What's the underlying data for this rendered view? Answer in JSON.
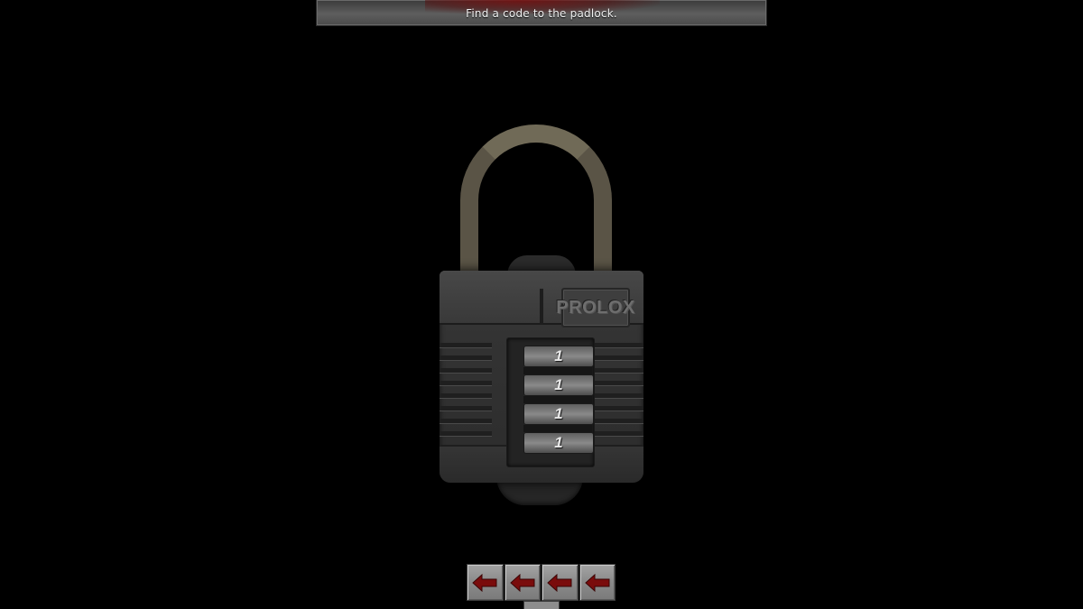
{
  "hint": {
    "text": "Find a code to the padlock."
  },
  "padlock": {
    "brand": "PROLOX",
    "dials": [
      {
        "value": "1"
      },
      {
        "value": "1"
      },
      {
        "value": "1"
      },
      {
        "value": "1"
      }
    ]
  },
  "controls": {
    "buttons": [
      {
        "icon": "left-arrow-icon"
      },
      {
        "icon": "left-arrow-icon"
      },
      {
        "icon": "left-arrow-icon"
      },
      {
        "icon": "left-arrow-icon"
      }
    ],
    "arrow_color": "#7a0c0c"
  },
  "colors": {
    "background": "#000000",
    "banner": "#4e4e4e",
    "blood": "#7a0f0f"
  }
}
